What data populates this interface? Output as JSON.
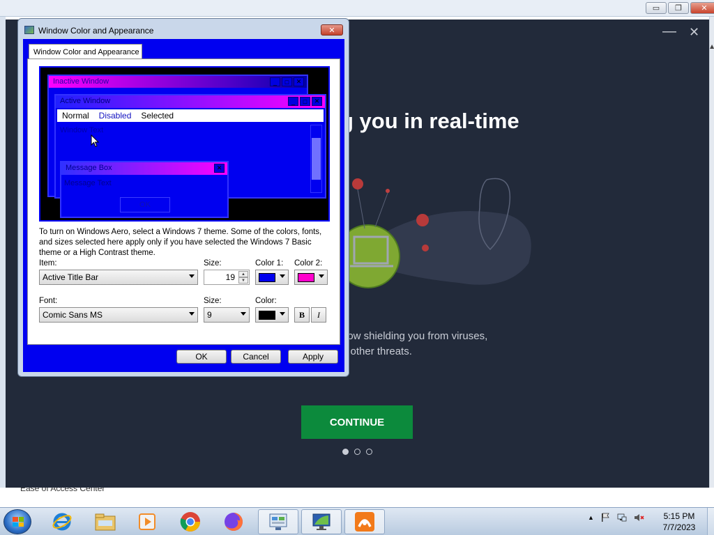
{
  "background_window": {
    "controls": {
      "minimize": "▭",
      "maximize": "❐",
      "close": "✕"
    },
    "partial_label": "Ease of Access Center"
  },
  "avast": {
    "heading_visible": "g you in real-time",
    "body_line1": "now shielding you from viruses,",
    "body_line2": "d other threats.",
    "continue_label": "CONTINUE",
    "minimize": "—",
    "close": "✕",
    "dots": 3,
    "accent_color": "#0c8a3c"
  },
  "dialog": {
    "title": "Window Color and Appearance",
    "tab_label": "Window Color and Appearance",
    "close": "✕",
    "preview": {
      "inactive_title": "Inactive Window",
      "active_title": "Active Window",
      "menu": {
        "normal": "Normal",
        "disabled": "Disabled",
        "selected": "Selected"
      },
      "window_text": "Window Text",
      "message_box_title": "Message Box",
      "message_text": "Message Text",
      "ok": "OK",
      "btn_min": "_",
      "btn_max": "□",
      "btn_close": "✕"
    },
    "description": "To turn on Windows Aero, select a Windows 7 theme.  Some of the colors, fonts, and sizes selected here apply only if you have selected the Windows 7 Basic theme or a High Contrast theme.",
    "item_label": "Item:",
    "item_value": "Active Title Bar",
    "size_label": "Size:",
    "size_value": "19",
    "color1_label": "Color 1:",
    "color1_value": "#0000ee",
    "color2_label": "Color 2:",
    "color2_value": "#ff00cc",
    "font_label": "Font:",
    "font_value": "Comic Sans MS",
    "font_size_label": "Size:",
    "font_size_value": "9",
    "font_color_label": "Color:",
    "font_color_value": "#000000",
    "bold": "B",
    "italic": "I",
    "ok": "OK",
    "cancel": "Cancel",
    "apply": "Apply"
  },
  "taskbar": {
    "apps": [
      "internet-explorer",
      "windows-explorer",
      "media-player",
      "chrome",
      "firefox",
      "control-panel",
      "display-settings",
      "avast"
    ],
    "clock_time": "5:15 PM",
    "clock_date": "7/7/2023"
  }
}
